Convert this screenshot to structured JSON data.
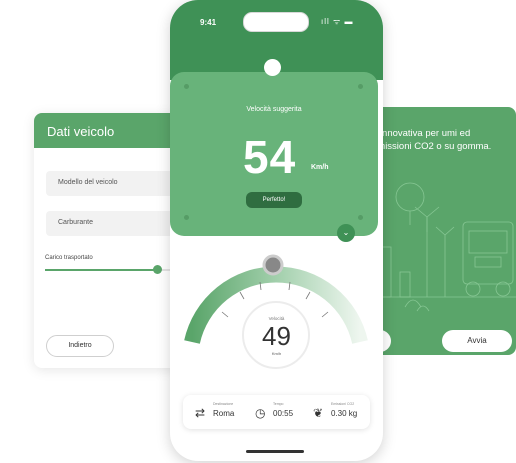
{
  "left_card": {
    "title": "Dati veicolo",
    "field_vehicle_model": "Modello del veicolo",
    "field_fuel": "Carburante",
    "slider_label": "Carico trasportato",
    "slider_level": 0.8,
    "back_button": "Indietro"
  },
  "right_card": {
    "text": "e innovativa per umi ed emissioni CO2 o su gomma.",
    "start_button": "Avvia"
  },
  "phone": {
    "time": "9:41",
    "status_icons": "ıll ᯤ ▬",
    "suggested_speed_label": "Velocità suggerita",
    "suggested_speed_value": "54",
    "suggested_speed_unit": "Km/h",
    "status_button": "Perfetto!",
    "gauge": {
      "label": "Velocità",
      "value": "49",
      "unit": "Km/h"
    },
    "info": {
      "destination_label": "Destinazione",
      "destination_value": "Roma",
      "time_label": "Tempo",
      "time_value": "00:55",
      "emissions_label": "Emissioni CO2",
      "emissions_value": "0.30 kg"
    }
  },
  "colors": {
    "primary_green": "#3f9156",
    "card_green": "#68b37a",
    "dark_green": "#2f6d40"
  }
}
